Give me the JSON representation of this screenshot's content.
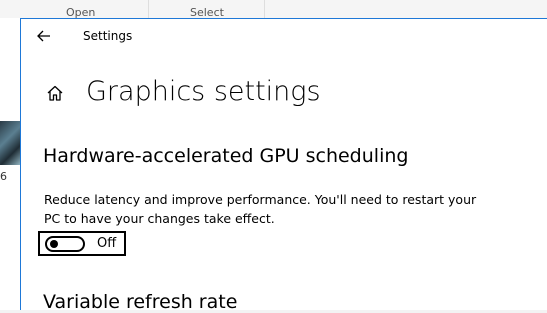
{
  "background": {
    "ribbon_groups": [
      "Open",
      "Select"
    ],
    "thumbnail_label": "6"
  },
  "settings": {
    "app_title": "Settings",
    "page_title": "Graphics settings",
    "gpu_section": {
      "title": "Hardware-accelerated GPU scheduling",
      "description": "Reduce latency and improve performance. You'll need to restart your PC to have your changes take effect.",
      "toggle": {
        "state_label": "Off",
        "on": false
      }
    },
    "vrr_section": {
      "title": "Variable refresh rate"
    }
  },
  "icons": {
    "back": "arrow-left-icon",
    "home": "home-icon"
  },
  "colors": {
    "window_border": "#1e78d7",
    "background": "#ffffff"
  }
}
